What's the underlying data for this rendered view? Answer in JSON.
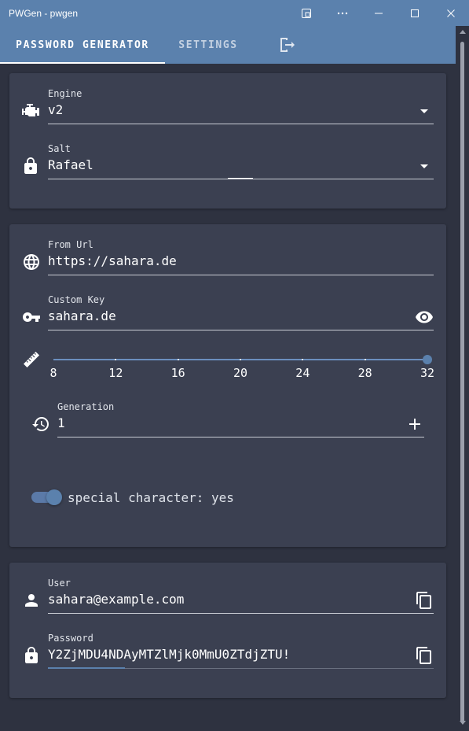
{
  "window": {
    "title": "PWGen - pwgen"
  },
  "tabs": {
    "generator": "PASSWORD GENERATOR",
    "settings": "SETTINGS"
  },
  "engine": {
    "label": "Engine",
    "value": "v2"
  },
  "salt": {
    "label": "Salt",
    "value": "Rafael"
  },
  "url": {
    "label": "From Url",
    "value": "https://sahara.de"
  },
  "custom_key": {
    "label": "Custom Key",
    "value": "sahara.de"
  },
  "length_slider": {
    "ticks": [
      "8",
      "12",
      "16",
      "20",
      "24",
      "28",
      "32"
    ],
    "min": 8,
    "max": 32,
    "value": 32
  },
  "generation": {
    "label": "Generation",
    "value": "1"
  },
  "special_character": {
    "label": "special character: yes",
    "enabled": true
  },
  "user": {
    "label": "User",
    "value": "sahara@example.com"
  },
  "password": {
    "label": "Password",
    "value": "Y2ZjMDU4NDAyMTZlMjk0MmU0ZTdjZTU!",
    "strength": 0.2
  },
  "colors": {
    "accent": "#5b81ad",
    "background": "#2e3240",
    "card": "#3b4051"
  }
}
